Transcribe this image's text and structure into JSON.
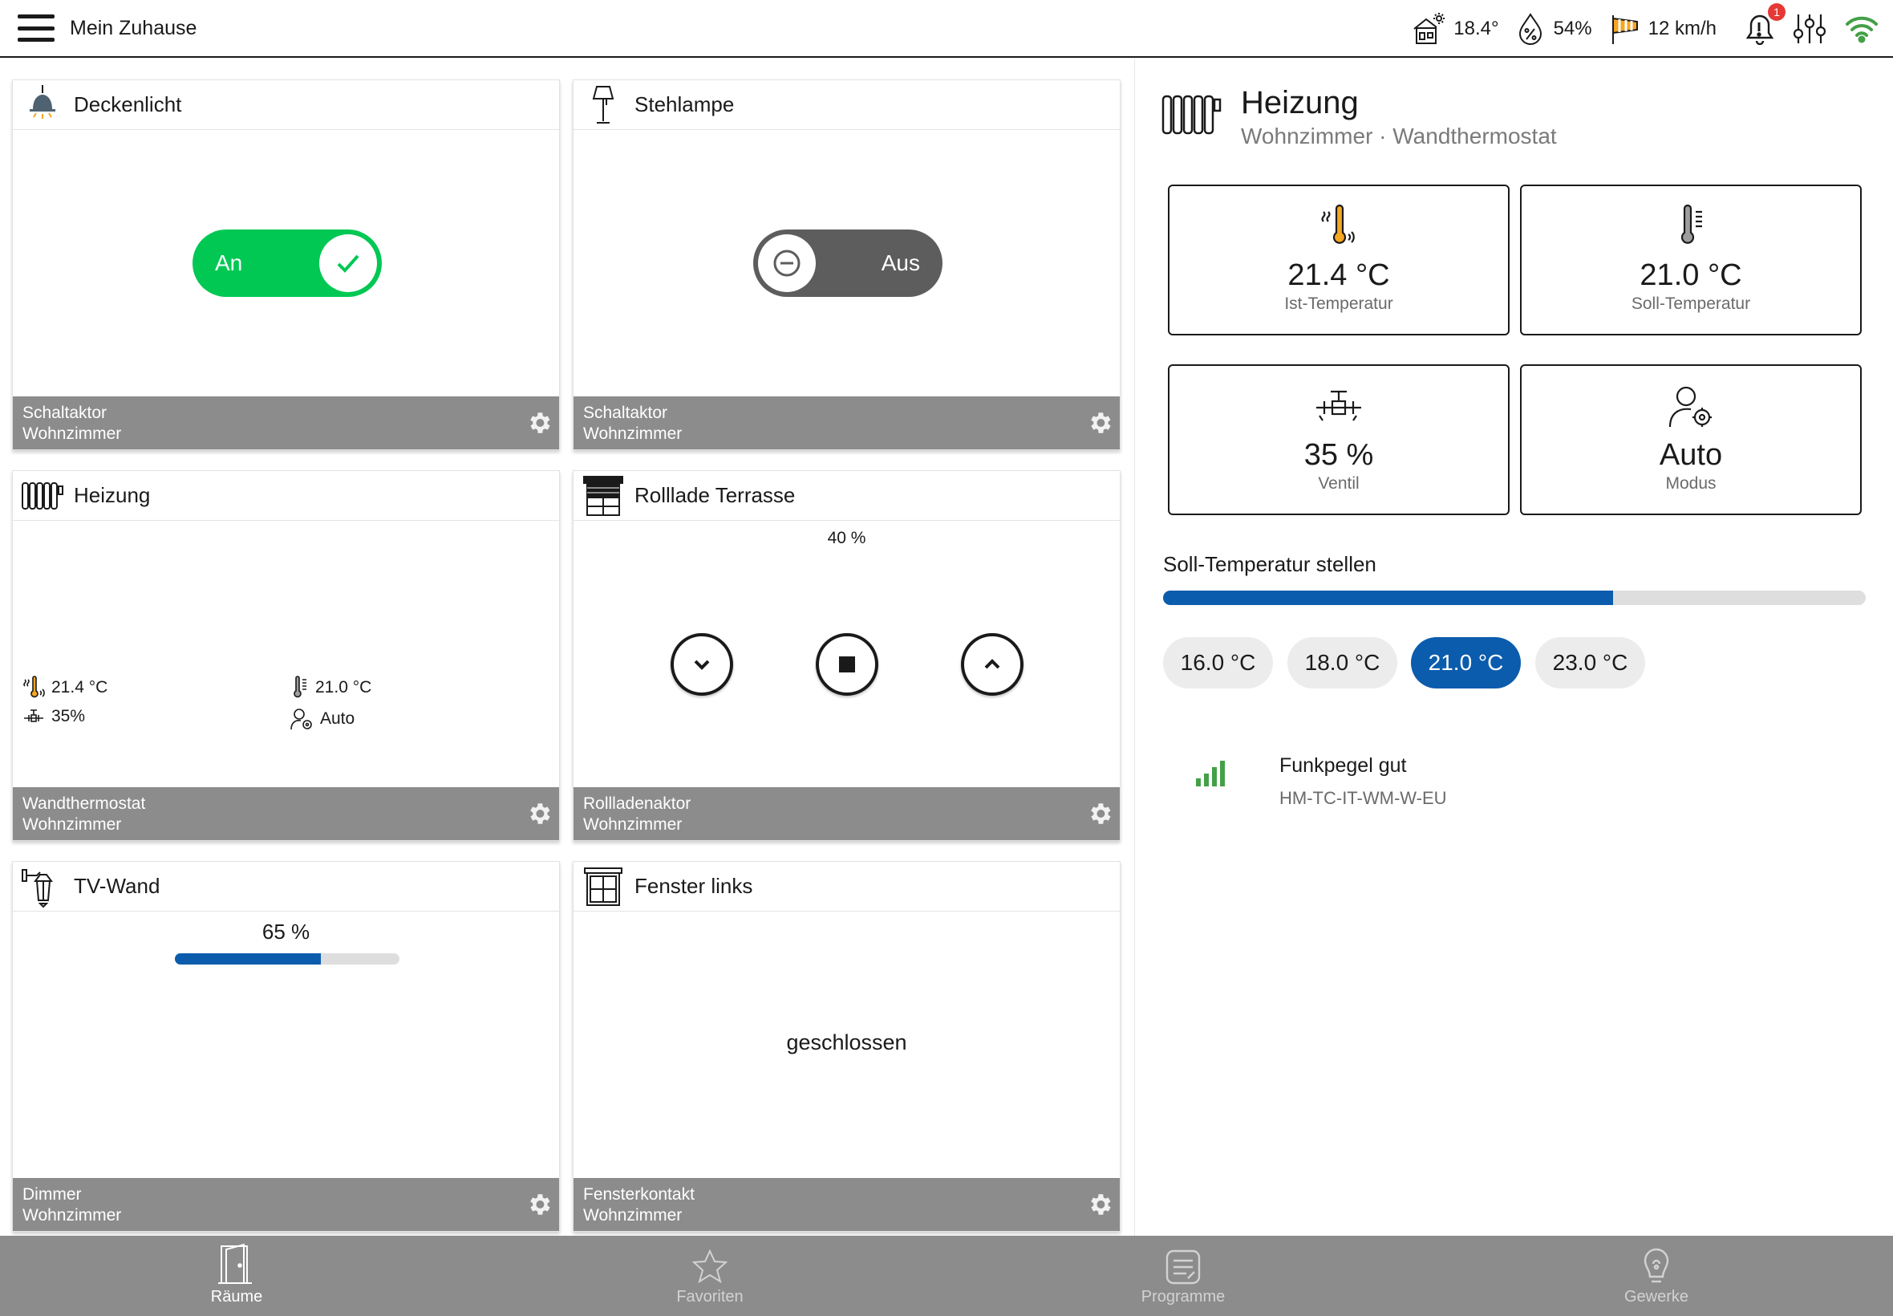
{
  "app": {
    "title": "Mein Zuhause"
  },
  "status": {
    "temperature": "18.4°",
    "humidity": "54%",
    "wind": "12 km/h",
    "notifications": "1"
  },
  "colors": {
    "accent": "#0b5cad",
    "on": "#00c853",
    "footer": "#8c8c8c",
    "signal": "#43a047"
  },
  "tiles": {
    "deckenlicht": {
      "title": "Deckenlicht",
      "switch_label": "An",
      "state": "on",
      "footer1": "Schaltaktor",
      "footer2": "Wohnzimmer",
      "icon": "ceiling-lamp-icon"
    },
    "stehlampe": {
      "title": "Stehlampe",
      "switch_label": "Aus",
      "state": "off",
      "footer1": "Schaltaktor",
      "footer2": "Wohnzimmer",
      "icon": "floor-lamp-icon"
    },
    "heizung": {
      "title": "Heizung",
      "ist": "21.4 °C",
      "soll": "21.0 °C",
      "ventil": "35%",
      "modus": "Auto",
      "footer1": "Wandthermostat",
      "footer2": "Wohnzimmer",
      "icon": "radiator-icon"
    },
    "rollladen": {
      "title": "Rolllade Terrasse",
      "position": "40 %",
      "footer1": "Rollladenaktor",
      "footer2": "Wohnzimmer",
      "icon": "shutter-icon"
    },
    "tvwand": {
      "title": "TV-Wand",
      "level_label": "65 %",
      "level": 0.65,
      "footer1": "Dimmer",
      "footer2": "Wohnzimmer",
      "icon": "wall-lamp-icon"
    },
    "fenster": {
      "title": "Fenster links",
      "state": "geschlossen",
      "footer1": "Fensterkontakt",
      "footer2": "Wohnzimmer",
      "icon": "window-icon"
    }
  },
  "detail": {
    "title": "Heizung",
    "subtitle": "Wohnzimmer · Wandthermostat",
    "cards": [
      {
        "value": "21.4 °C",
        "label": "Ist-Temperatur",
        "icon": "thermometer-heat-icon"
      },
      {
        "value": "21.0 °C",
        "label": "Soll-Temperatur",
        "icon": "thermometer-scale-icon"
      },
      {
        "value": "35 %",
        "label": "Ventil",
        "icon": "valve-icon"
      },
      {
        "value": "Auto",
        "label": "Modus",
        "icon": "user-gear-icon"
      }
    ],
    "setpoint_heading": "Soll-Temperatur stellen",
    "setpoint_level": 0.64,
    "presets": [
      "16.0 °C",
      "18.0 °C",
      "21.0 °C",
      "23.0 °C"
    ],
    "active_preset": 2,
    "signal_title": "Funkpegel gut",
    "device_id": "HM-TC-IT-WM-W-EU"
  },
  "nav": [
    {
      "label": "Räume",
      "icon": "door-icon",
      "active": true
    },
    {
      "label": "Favoriten",
      "icon": "star-icon",
      "active": false
    },
    {
      "label": "Programme",
      "icon": "programs-icon",
      "active": false
    },
    {
      "label": "Gewerke",
      "icon": "trades-icon",
      "active": false
    }
  ]
}
